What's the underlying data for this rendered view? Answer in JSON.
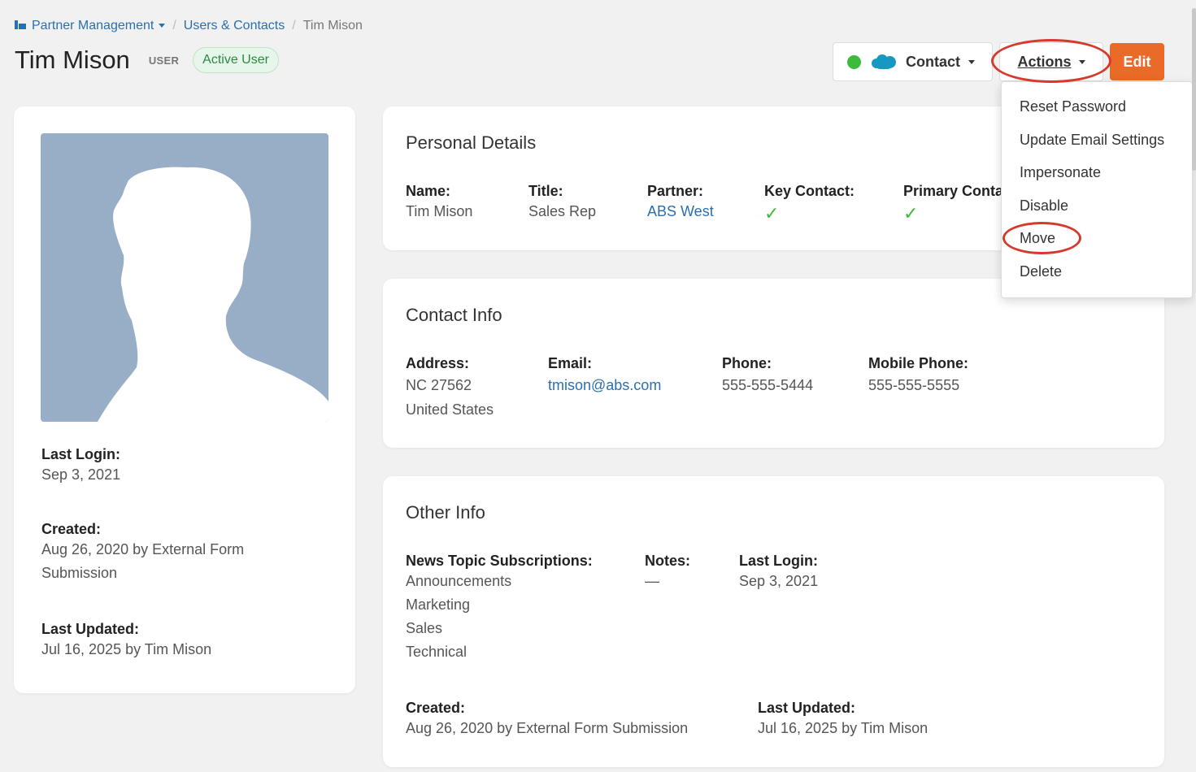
{
  "breadcrumb": {
    "root": "Partner Management",
    "section": "Users & Contacts",
    "current": "Tim Mison"
  },
  "header": {
    "title": "Tim Mison",
    "role": "USER",
    "status": "Active User"
  },
  "toolbar": {
    "contact_label": "Contact",
    "actions_label": "Actions",
    "edit_label": "Edit"
  },
  "actions_menu": [
    "Reset Password",
    "Update Email Settings",
    "Impersonate",
    "Disable",
    "Move",
    "Delete"
  ],
  "sidebar": {
    "last_login_label": "Last Login:",
    "last_login": "Sep 3, 2021",
    "created_label": "Created:",
    "created_line1": "Aug 26, 2020 by External Form",
    "created_line2": "Submission",
    "updated_label": "Last Updated:",
    "updated": "Jul 16, 2025 by Tim Mison"
  },
  "personal": {
    "title": "Personal Details",
    "name_label": "Name:",
    "name": "Tim Mison",
    "title_label": "Title:",
    "job_title": "Sales Rep",
    "partner_label": "Partner:",
    "partner": "ABS West",
    "key_contact_label": "Key Contact:",
    "primary_contact_label": "Primary Contact:"
  },
  "contact": {
    "title": "Contact Info",
    "address_label": "Address:",
    "address_line1": "NC 27562",
    "address_line2": "United States",
    "email_label": "Email:",
    "email": "tmison@abs.com",
    "phone_label": "Phone:",
    "phone": "555-555-5444",
    "mobile_label": "Mobile Phone:",
    "mobile": "555-555-5555"
  },
  "other": {
    "title": "Other Info",
    "subs_label": "News Topic Subscriptions:",
    "subscriptions": [
      "Announcements",
      "Marketing",
      "Sales",
      "Technical"
    ],
    "notes_label": "Notes:",
    "notes": "—",
    "last_login_label": "Last Login:",
    "last_login": "Sep 3, 2021",
    "created_label": "Created:",
    "created": "Aug 26, 2020 by External Form Submission",
    "updated_label": "Last Updated:",
    "updated": "Jul 16, 2025 by Tim Mison"
  },
  "colors": {
    "accent": "#2a6fb0",
    "edit": "#ea6a27",
    "highlight": "#d63a2c",
    "success": "#3dbb3d"
  }
}
